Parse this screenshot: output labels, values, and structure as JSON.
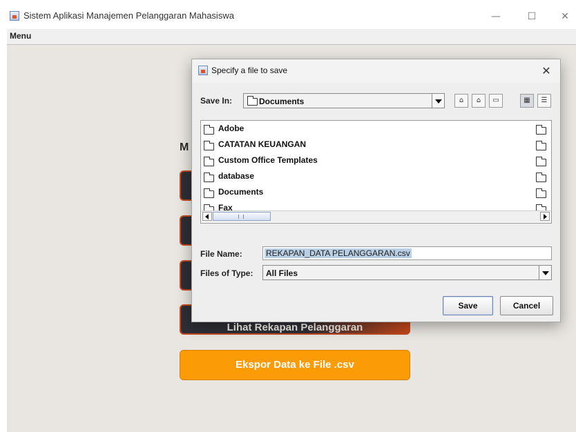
{
  "window": {
    "title": "Sistem Aplikasi Manajemen Pelanggaran Mahasiswa",
    "minimize": "—",
    "maximize": "☐",
    "close": "✕"
  },
  "menubar": {
    "menu_label": "Menu"
  },
  "background": {
    "heading_partial": "M",
    "partial_button_label": "Lihat Rekapan Pelanggaran",
    "export_button": "Ekspor Data ke File .csv"
  },
  "dialog": {
    "title": "Specify a file to save",
    "close": "✕",
    "save_in_label": "Save In:",
    "save_in_value": "Documents",
    "toolbar": [
      "up-folder-icon",
      "home-icon",
      "new-folder-icon",
      "list-view-icon",
      "details-view-icon"
    ],
    "files": [
      "Adobe",
      "CATATAN KEUANGAN",
      "Custom Office Templates",
      "database",
      "Documents",
      "Fax"
    ],
    "file_name_label": "File Name:",
    "file_name_value": "REKAPAN_DATA PELANGGARAN.csv",
    "files_of_type_label": "Files of Type:",
    "files_of_type_value": "All Files",
    "save_button": "Save",
    "cancel_button": "Cancel"
  },
  "colors": {
    "export_button": "#fb9b06",
    "dark_button": "#2e2e36",
    "accent_border": "#c1491d",
    "selection": "#b8cfe5"
  }
}
